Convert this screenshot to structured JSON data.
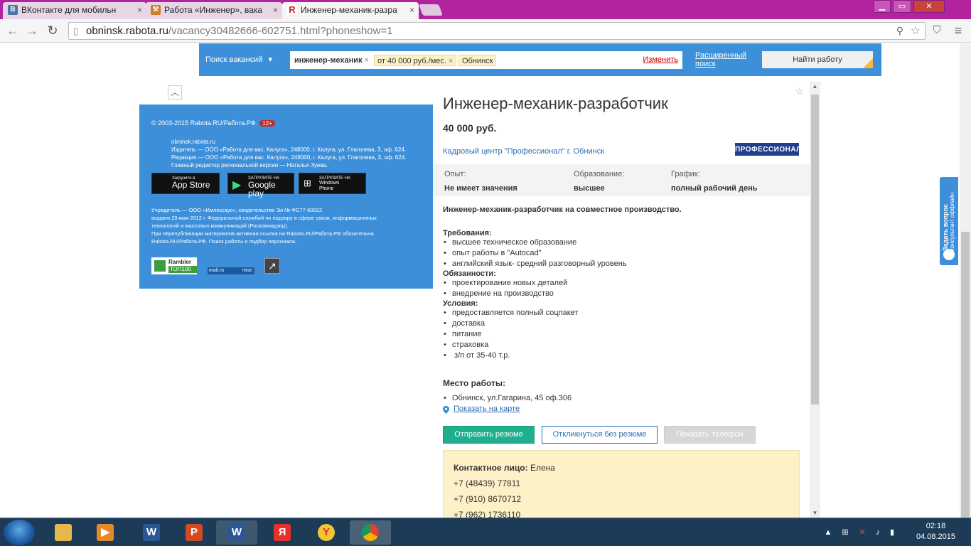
{
  "browser": {
    "tabs": [
      {
        "label": "ВКонтакте для мобильн",
        "icon": "vk-icon"
      },
      {
        "label": "Работа «Инженер», вака",
        "icon": "hammer-icon"
      },
      {
        "label": "Инженер-механик-разра",
        "icon": "rabota-r-icon"
      }
    ],
    "url_host": "obninsk.rabota.ru",
    "url_path": "/vacancy30482666-602751.html?phoneshow=1"
  },
  "searchbar": {
    "label": "Поиск вакансий",
    "query": "инженер-механик",
    "chip_salary": "от 40 000 руб./мес.",
    "chip_city": "Обнинск",
    "change_label": "Изменить",
    "advanced_line1": "Расширенный",
    "advanced_line2": "поиск",
    "find_label": "Найти работу"
  },
  "footer": {
    "copyright": "© 2003-2015 Rabota.RU/Работа.РФ.",
    "age": "12+",
    "site": "obninsk.rabota.ru",
    "publisher": "Издатель — ООО «Работа для вас. Калуга», 248000, г. Калуга, ул. Глаголева, 3, оф. 624.",
    "editorial": "Редакция — ООО «Работа для вас. Калуга», 248000, г. Калуга, ул. Глаголева, 3, оф. 624.",
    "editor": "Главный редактор региональной версии — Наталья Зуева.",
    "appstore_small": "Загрузите в",
    "appstore_big": "App Store",
    "googleplay_small": "ЗАГРУЗИТЕ НА",
    "googleplay_big": "Google play",
    "windows_small": "ЗАГРУЗИТЕ НА",
    "windows_big": "Windows",
    "windows_big2": "Phone",
    "legal1": "Учредитель — ООО «Имлексаус», свидетельство Эл № ФС77-60022",
    "legal2": "выдано 29 мая 2012 г. Федеральной службой по надзору в сфере связи, информационных",
    "legal3": "технологий и массовых коммуникаций (Роскомнадзор).",
    "legal4": "При перепубликации материалов активная ссылка на Rabota.RU/Работа.РФ обязательна.",
    "legal5": "Rabota.RU/Работа.РФ. Поиск работы и подбор персонала.",
    "rambler_line1": "Rambler",
    "rambler_line2": "ТОП100",
    "mail_label": "mail.ru",
    "mail_count": "79698"
  },
  "vacancy": {
    "title": "Инженер-механик-разработчик",
    "salary": "40 000 руб.",
    "company": "Кадровый центр \"Профессионал\" г. Обнинск",
    "logo_text": "ПРОФЕССИОНАЛ",
    "params": {
      "experience_label": "Опыт:",
      "experience_value": "Не имеет значения",
      "education_label": "Образование:",
      "education_value": "высшее",
      "schedule_label": "График:",
      "schedule_value": "полный рабочий день"
    },
    "intro": "Инженер-механик-разработчик на совместное производство.",
    "requirements_title": "Требования:",
    "requirements": [
      "высшее техническое образование",
      "опыт работы в \"Autocad\"",
      "английский язык- средний разговорный уровень"
    ],
    "duties_title": "Обязанности:",
    "duties": [
      "проектирование новых деталей",
      "внедрение на производство"
    ],
    "conditions_title": "Условия:",
    "conditions": [
      "предоставляется полный соцпакет",
      "доставка",
      "питание",
      "страховка",
      " з/п от 35-40 т.р."
    ],
    "workplace_title": "Место работы:",
    "address": "Обнинск, ул.Гагарина, 45 оф.306",
    "map_link": "Показать на карте",
    "btn_resume": "Отправить резюме",
    "btn_noresume": "Откликнуться без резюме",
    "btn_phone": "Показать телефон",
    "contact_label": "Контактное лицо:",
    "contact_name": "Елена",
    "phones": [
      "+7 (48439) 77811",
      "+7 (910) 8670712",
      "+7 (962) 1736110"
    ]
  },
  "widget": {
    "line1": "Задать вопрос",
    "line2": "консультант оффлайн"
  },
  "taskbar": {
    "time": "02:18",
    "date": "04.08.2015"
  }
}
